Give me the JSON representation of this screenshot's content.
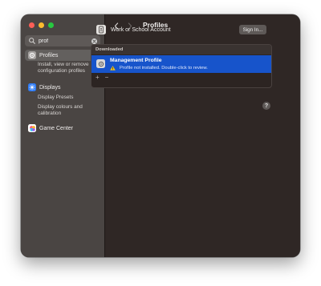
{
  "window": {
    "title": "Profiles"
  },
  "search": {
    "value": "prof",
    "placeholder": "Search"
  },
  "sidebar": {
    "items": [
      {
        "label": "Profiles",
        "icon": "gear-icon",
        "selected": true
      },
      {
        "label": "Displays",
        "icon": "sun-icon",
        "color": "#2f7cf6"
      },
      {
        "label": "Game Center",
        "icon": "game-center-icon"
      }
    ],
    "profiles_description": "Install, view or remove configuration profiles",
    "displays_sub": [
      "Display Presets",
      "Display colours and calibration"
    ]
  },
  "account": {
    "label": "Work or School Account",
    "button": "Sign In..."
  },
  "downloaded": {
    "header": "Downloaded",
    "profile_name": "Management Profile",
    "profile_status": "Profile not installed. Double-click to review.",
    "add_label": "+",
    "remove_label": "−",
    "highlight_color": "#1754cb"
  },
  "help": {
    "label": "?"
  }
}
